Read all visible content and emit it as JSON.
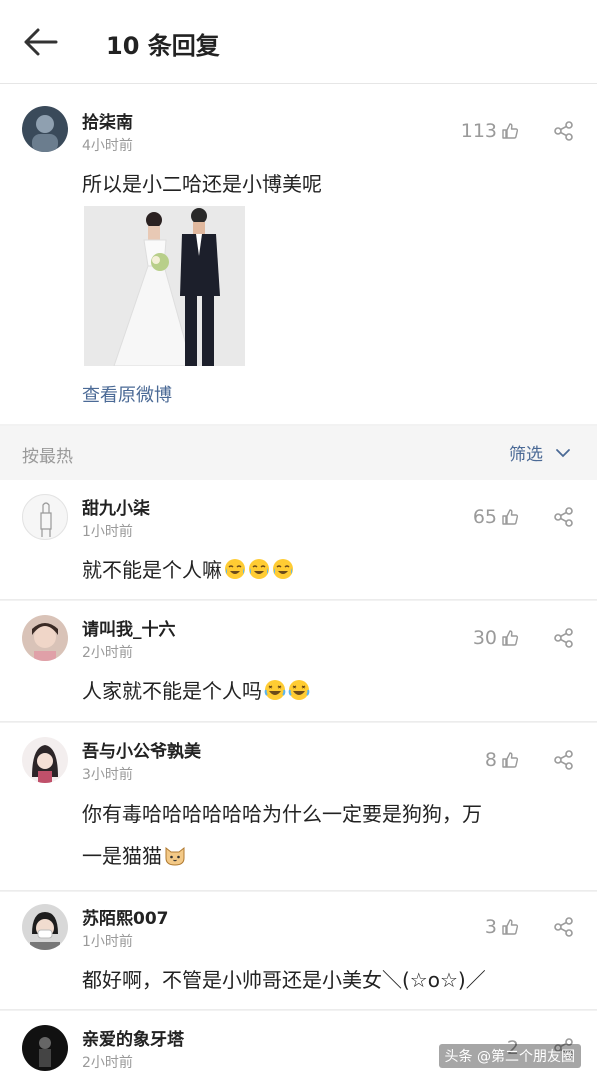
{
  "header": {
    "title": "10 条回复"
  },
  "post": {
    "username": "拾柒南",
    "time": "4小时前",
    "likes": "113",
    "text": "所以是小二哈还是小博美呢",
    "view_original": "查看原微博"
  },
  "sort": {
    "label": "按最热",
    "filter_label": "筛选"
  },
  "comments": [
    {
      "username": "甜九小柒",
      "time": "1小时前",
      "likes": "65",
      "text": "就不能是个人嘛"
    },
    {
      "username": "请叫我_十六",
      "time": "2小时前",
      "likes": "30",
      "text": "人家就不能是个人吗"
    },
    {
      "username": "吾与小公爷孰美",
      "time": "3小时前",
      "likes": "8",
      "text_line1": "你有毒哈哈哈哈哈哈为什么一定要是狗狗，万",
      "text_line2": "一是猫猫"
    },
    {
      "username": "苏陌熙007",
      "time": "1小时前",
      "likes": "3",
      "text": "都好啊，不管是小帅哥还是小美女＼(☆o☆)／"
    },
    {
      "username": "亲爱的象牙塔",
      "time": "2小时前",
      "likes": "2"
    }
  ],
  "watermark": "头条 @第二个朋友圈",
  "colors": {
    "link": "#4b6a96",
    "muted": "#9a9a9a"
  }
}
